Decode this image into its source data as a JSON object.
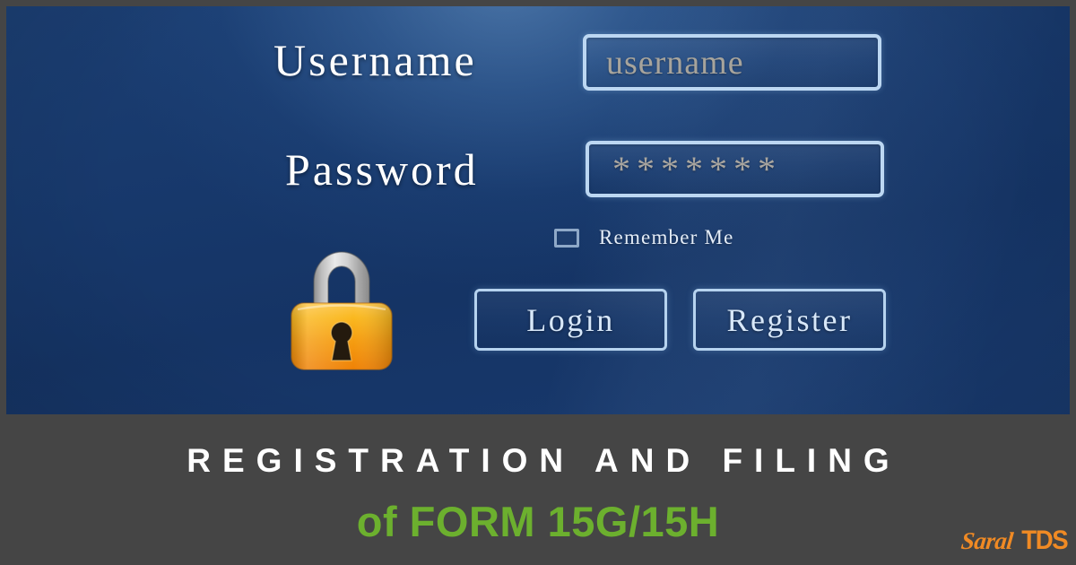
{
  "poster": {
    "frame_color": "#454545",
    "panel_gradient_from": "#1b3e72",
    "panel_gradient_to": "#153465"
  },
  "login_form": {
    "username": {
      "label": "Username",
      "placeholder": "username",
      "value": "username"
    },
    "password": {
      "label": "Password",
      "value": "*******",
      "masked_char_count": 7
    },
    "remember_me": {
      "label": "Remember Me",
      "checked": false
    },
    "buttons": {
      "login": "Login",
      "register": "Register"
    },
    "padlock": {
      "icon": "padlock-icon",
      "body_color": "#f5a623",
      "shackle_color": "#c9c9c9"
    },
    "field_border_color": "#bcd7f2",
    "placeholder_color": "#a7a49c"
  },
  "caption": {
    "headline_primary": "REGISTRATION AND FILING",
    "headline_secondary": "of FORM 15G/15H",
    "primary_color": "#ffffff",
    "secondary_color": "#6cb02e",
    "band_color": "#454545"
  },
  "brand": {
    "name_script": "Saral",
    "name_mark": "TDS",
    "color": "#f08a24"
  }
}
